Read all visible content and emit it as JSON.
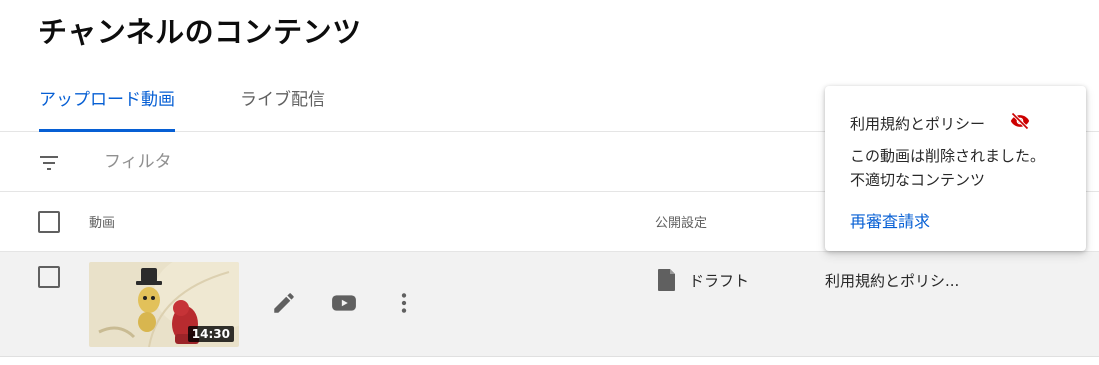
{
  "page": {
    "title": "チャンネルのコンテンツ"
  },
  "tabs": [
    {
      "label": "アップロード動画",
      "active": true
    },
    {
      "label": "ライブ配信",
      "active": false
    }
  ],
  "filter": {
    "icon": "filter-icon",
    "placeholder": "フィルタ"
  },
  "table": {
    "columns": {
      "video": "動画",
      "visibility": "公開設定"
    },
    "rows": [
      {
        "duration": "14:30",
        "actions": [
          "edit-icon",
          "youtube-icon",
          "more-vert-icon"
        ],
        "visibility": {
          "icon": "draft-icon",
          "label": "ドラフト"
        },
        "restrictions": "利用規約とポリシ..."
      }
    ]
  },
  "popover": {
    "title": "利用規約とポリシー",
    "icon": "visibility-off-icon",
    "line1": "この動画は削除されました。",
    "line2": "不適切なコンテンツ",
    "link": "再審査請求"
  },
  "colors": {
    "accent": "#065fd4",
    "warning_icon": "#cc0000",
    "row_background": "#f2f2f2"
  }
}
